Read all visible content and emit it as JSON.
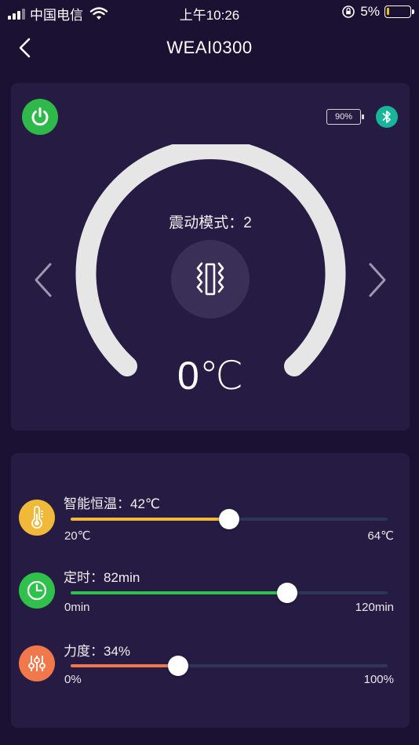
{
  "status_bar": {
    "carrier": "中国电信",
    "time": "上午10:26",
    "battery_percent": "5%"
  },
  "nav": {
    "title": "WEAI0300",
    "back_icon": "chevron-left-icon"
  },
  "device": {
    "battery_text": "90%",
    "power_icon": "power-icon",
    "bluetooth_icon": "bluetooth-icon",
    "mode_label": "震动模式：2",
    "mode_icon": "vibration-icon",
    "temperature": "0℃"
  },
  "controls": [
    {
      "id": "smart-temp",
      "label": "智能恒温：42℃",
      "min_label": "20℃",
      "max_label": "64℃",
      "fraction": 0.5,
      "color": "#f0b93a",
      "icon": "thermometer-icon"
    },
    {
      "id": "timer",
      "label": "定时：82min",
      "min_label": "0min",
      "max_label": "120min",
      "fraction": 0.683,
      "color": "#2fc14c",
      "icon": "clock-icon"
    },
    {
      "id": "strength",
      "label": "力度：34%",
      "min_label": "0%",
      "max_label": "100%",
      "fraction": 0.34,
      "color": "#f0784a",
      "icon": "sliders-icon"
    }
  ],
  "colors": {
    "background": "#1a1133",
    "card": "#261c43",
    "power": "#2fb94a",
    "bluetooth": "#18b59a",
    "gauge": "#e6e6e6"
  }
}
